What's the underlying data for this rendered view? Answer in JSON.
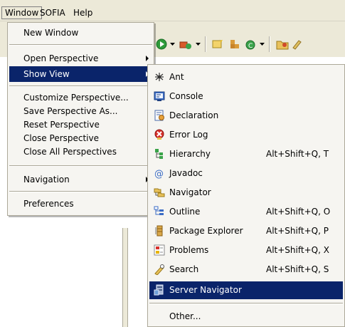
{
  "menubar": {
    "items": [
      "Window",
      "SOFIA",
      "Help"
    ]
  },
  "window_menu": {
    "items": [
      {
        "label": "New Window"
      },
      {
        "label": "Open Perspective",
        "submenu": true
      },
      {
        "label": "Show View",
        "submenu": true,
        "highlighted": true
      },
      {
        "label": "Customize Perspective..."
      },
      {
        "label": "Save Perspective As..."
      },
      {
        "label": "Reset Perspective"
      },
      {
        "label": "Close Perspective"
      },
      {
        "label": "Close All Perspectives"
      },
      {
        "label": "Navigation",
        "submenu": true
      },
      {
        "label": "Preferences"
      }
    ]
  },
  "show_view_menu": {
    "items": [
      {
        "label": "Ant",
        "icon": "ant-icon",
        "shortcut": ""
      },
      {
        "label": "Console",
        "icon": "console-icon",
        "shortcut": ""
      },
      {
        "label": "Declaration",
        "icon": "declaration-icon",
        "shortcut": ""
      },
      {
        "label": "Error Log",
        "icon": "error-log-icon",
        "shortcut": ""
      },
      {
        "label": "Hierarchy",
        "icon": "hierarchy-icon",
        "shortcut": "Alt+Shift+Q, T"
      },
      {
        "label": "Javadoc",
        "icon": "javadoc-icon",
        "shortcut": ""
      },
      {
        "label": "Navigator",
        "icon": "navigator-icon",
        "shortcut": ""
      },
      {
        "label": "Outline",
        "icon": "outline-icon",
        "shortcut": "Alt+Shift+Q, O"
      },
      {
        "label": "Package Explorer",
        "icon": "package-explorer-icon",
        "shortcut": "Alt+Shift+Q, P"
      },
      {
        "label": "Problems",
        "icon": "problems-icon",
        "shortcut": "Alt+Shift+Q, X"
      },
      {
        "label": "Search",
        "icon": "search-icon",
        "shortcut": "Alt+Shift+Q, S"
      },
      {
        "label": "Server Navigator",
        "icon": "server-navigator-icon",
        "shortcut": "",
        "highlighted": true
      },
      {
        "label": "Other...",
        "icon": "",
        "shortcut": ""
      }
    ]
  },
  "colors": {
    "highlight": "#0a246a",
    "menu_bg": "#f6f5f1",
    "chrome": "#ece9d8"
  }
}
